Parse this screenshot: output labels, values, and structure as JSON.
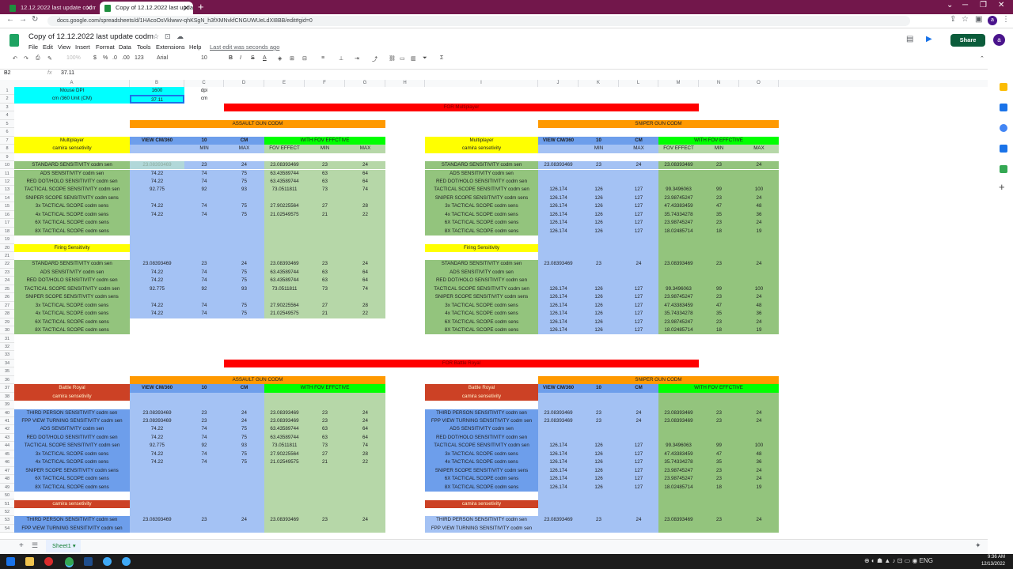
{
  "browser": {
    "tabs": [
      {
        "title": "12.12.2022 last update codm - G"
      },
      {
        "title": "Copy of 12.12.2022 last update c"
      }
    ],
    "url": "docs.google.com/spreadsheets/d/1HAcoOsVklwwv-qhKSgN_h3fXMNvkfCNGUWUeLdXI8BB/edit#gid=0"
  },
  "sheet": {
    "title": "Copy of 12.12.2022 last update codm",
    "menu": [
      "File",
      "Edit",
      "View",
      "Insert",
      "Format",
      "Data",
      "Tools",
      "Extensions",
      "Help"
    ],
    "last_edit": "Last edit was seconds ago",
    "share_label": "Share",
    "avatar_letter": "a",
    "toolbar": {
      "zoom": "100%",
      "currency": "$",
      "percent": "%",
      "dec1": ".0",
      "dec2": ".00",
      "fmt": "123",
      "font": "Arial",
      "size": "10"
    },
    "name_box": "B2",
    "fx": "fx",
    "formula": "37.11",
    "sheet_tab": "Sheet1"
  },
  "grid": {
    "columns": [
      "A",
      "B",
      "C",
      "D",
      "E",
      "F",
      "G",
      "H",
      "I",
      "J",
      "K",
      "L",
      "M",
      "N",
      "O"
    ],
    "rows": [
      "1",
      "2",
      "3",
      "4",
      "5",
      "6",
      "7",
      "8",
      "9",
      "10",
      "11",
      "12",
      "13",
      "14",
      "15",
      "16",
      "17",
      "18",
      "19",
      "20",
      "21",
      "22",
      "23",
      "24",
      "25",
      "26",
      "27",
      "28",
      "29",
      "30",
      "31",
      "32",
      "33",
      "34",
      "35",
      "36",
      "37",
      "38",
      "39",
      "40",
      "41",
      "42",
      "43",
      "44",
      "45",
      "46",
      "47",
      "48",
      "49",
      "50",
      "51",
      "52",
      "53",
      "54"
    ],
    "header_cells": {
      "mouse_dpi": "Mouse DPI",
      "dpi_val": "1600",
      "dpi_unit": "dpi",
      "cm_label": "cm /360 Unit (CM)",
      "cm_val": "37.11",
      "cm_unit": "cm",
      "for_mp": "FOR Multiplayer",
      "for_br": "FOR Battle Royal",
      "ag": "ASSAULT GUN CODM",
      "sg": "SNIPER GUN CODM",
      "mp": "Multiplayer",
      "cs": "camira sensetivity",
      "fs": "Firing Sensitivity",
      "br": "Battle Royal",
      "vc": "VIEW CM/360",
      "ten": "10",
      "cm": "CM",
      "wf": "WITH FOV EFFCTIVE",
      "min": "MIN",
      "max": "MAX",
      "fov": "FOV  EFFECT"
    },
    "mp_labels": [
      "STANDARD SENSITIVITY codm sen",
      "ADS SENSITIVITY codm sen",
      "RED DOT/HOLO SENSITIVITY codm sen",
      "TACTICAL SCOPE SENSITIVITY codm sen",
      "SNIPER SCOPE SENSITIVITY codm sens",
      "3x TACTICAL SCOPE codm sens",
      "4x TACTICAL SCOPE codm sens",
      "6X TACTICAL SCOPE codm sens",
      "8X TACTICAL SCOPE codm sens"
    ],
    "br_labels": [
      "THIRD PERSON SENSITIVITY codm sen",
      "FPP VIEW TURNING SENSITIVITY codm sen",
      "ADS SENSITIVITY codm sen",
      "RED DOT/HOLO SENSITIVITY codm sen",
      "TACTICAL SCOPE SENSITIVITY codm sen",
      "3x TACTICAL SCOPE codm sens",
      "4x TACTICAL SCOPE codm sens",
      "SNIPER SCOPE SENSITIVITY codm sens",
      "6X TACTICAL SCOPE codm sens",
      "8X TACTICAL SCOPE codm sens"
    ],
    "mp_assault": [
      [
        "23.08393469",
        "23",
        "24",
        "23.08393469",
        "23",
        "24"
      ],
      [
        "74.22",
        "74",
        "75",
        "63.43589744",
        "63",
        "64"
      ],
      [
        "74.22",
        "74",
        "75",
        "63.43589744",
        "63",
        "64"
      ],
      [
        "92.775",
        "92",
        "93",
        "73.0511811",
        "73",
        "74"
      ],
      [
        "",
        "",
        "",
        "",
        "",
        ""
      ],
      [
        "74.22",
        "74",
        "75",
        "27.90225564",
        "27",
        "28"
      ],
      [
        "74.22",
        "74",
        "75",
        "21.02549575",
        "21",
        "22"
      ],
      [
        "",
        "",
        "",
        "",
        "",
        ""
      ],
      [
        "",
        "",
        "",
        "",
        "",
        ""
      ]
    ],
    "mp_sniper": [
      [
        "23.08393469",
        "23",
        "24",
        "23.08393469",
        "23",
        "24"
      ],
      [
        "",
        "",
        "",
        "",
        "",
        ""
      ],
      [
        "",
        "",
        "",
        "",
        "",
        ""
      ],
      [
        "126.174",
        "126",
        "127",
        "99.3496063",
        "99",
        "100"
      ],
      [
        "126.174",
        "126",
        "127",
        "23.98745247",
        "23",
        "24"
      ],
      [
        "126.174",
        "126",
        "127",
        "47.43383459",
        "47",
        "48"
      ],
      [
        "126.174",
        "126",
        "127",
        "35.74334278",
        "35",
        "36"
      ],
      [
        "126.174",
        "126",
        "127",
        "23.98745247",
        "23",
        "24"
      ],
      [
        "126.174",
        "126",
        "127",
        "18.02485714",
        "18",
        "19"
      ]
    ],
    "br_assault": [
      [
        "23.08393469",
        "23",
        "24",
        "23.08393469",
        "23",
        "24"
      ],
      [
        "23.08393469",
        "23",
        "24",
        "23.08393469",
        "23",
        "24"
      ],
      [
        "74.22",
        "74",
        "75",
        "63.43589744",
        "63",
        "64"
      ],
      [
        "74.22",
        "74",
        "75",
        "63.43589744",
        "63",
        "64"
      ],
      [
        "92.775",
        "92",
        "93",
        "73.0511811",
        "73",
        "74"
      ],
      [
        "74.22",
        "74",
        "75",
        "27.90225564",
        "27",
        "28"
      ],
      [
        "74.22",
        "74",
        "75",
        "21.02549575",
        "21",
        "22"
      ],
      [
        "",
        "",
        "",
        "",
        "",
        ""
      ],
      [
        "",
        "",
        "",
        "",
        "",
        ""
      ],
      [
        "",
        "",
        "",
        "",
        "",
        ""
      ]
    ],
    "br_sniper": [
      [
        "23.08393469",
        "23",
        "24",
        "23.08393469",
        "23",
        "24"
      ],
      [
        "23.08393469",
        "23",
        "24",
        "23.08393469",
        "23",
        "24"
      ],
      [
        "",
        "",
        "",
        "",
        "",
        ""
      ],
      [
        "",
        "",
        "",
        "",
        "",
        ""
      ],
      [
        "126.174",
        "126",
        "127",
        "99.3496063",
        "99",
        "100"
      ],
      [
        "126.174",
        "126",
        "127",
        "47.43383459",
        "47",
        "48"
      ],
      [
        "126.174",
        "126",
        "127",
        "35.74334278",
        "35",
        "36"
      ],
      [
        "126.174",
        "126",
        "127",
        "23.98745247",
        "23",
        "24"
      ],
      [
        "126.174",
        "126",
        "127",
        "23.98745247",
        "23",
        "24"
      ],
      [
        "126.174",
        "126",
        "127",
        "18.02485714",
        "18",
        "19"
      ]
    ],
    "br_last_row": [
      "THIRD PERSON SENSITIVITY codm sen",
      "23.08393469",
      "23",
      "24",
      "23.08393469",
      "23",
      "24"
    ],
    "br_cut_row_label": "FPP VIEW TURNING SENSITIVITY codm sen",
    "colors": {
      "cyan": "#00ffff",
      "red": "#ff0000",
      "orange": "#ff9900",
      "yellow": "#ffff00",
      "green": "#00ff00",
      "blue": "#a4c2f4",
      "darkblue": "#6d9eeb",
      "lightgreen": "#b6d7a8",
      "midgreen": "#93c47d",
      "brown": "#cc4125",
      "lightblue": "#a4c2f4"
    }
  },
  "taskbar": {
    "time": "9:36 AM",
    "date": "12/13/2022"
  }
}
